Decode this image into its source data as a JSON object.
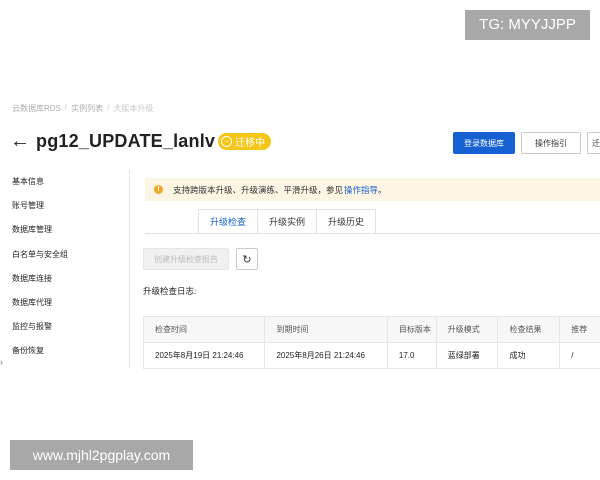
{
  "watermarks": {
    "top": "TG: MYYJJPP",
    "bottom": "www.mjhl2pgplay.com"
  },
  "breadcrumb": [
    "云数据库RDS",
    "实例列表",
    "大版本升级"
  ],
  "header": {
    "title": "pg12_UPDATE_lanlv",
    "status": "迁移中",
    "buttons": {
      "login": "登录数据库",
      "guide": "操作指引",
      "migrate_cut": "迁"
    }
  },
  "sidebar": {
    "items": [
      "基本信息",
      "账号管理",
      "数据库管理",
      "白名单与安全组",
      "数据库连接",
      "数据库代理",
      "监控与报警",
      "备份恢复"
    ]
  },
  "notice": {
    "text": "支持跨版本升级、升级演练、平滑升级，参见",
    "link": "操作指导",
    "suffix": "。"
  },
  "tabs": [
    "升级检查",
    "升级实例",
    "升级历史"
  ],
  "actions": {
    "create_check": "创建升级检查报告"
  },
  "log_label": "升级检查日志:",
  "table": {
    "headers": [
      "检查时间",
      "到期时间",
      "目标版本",
      "升级模式",
      "检查结果",
      "推荐"
    ],
    "rows": [
      [
        "2025年8月19日 21:24:46",
        "2025年8月26日 21:24:46",
        "17.0",
        "蓝绿部署",
        "成功",
        "/"
      ]
    ]
  }
}
